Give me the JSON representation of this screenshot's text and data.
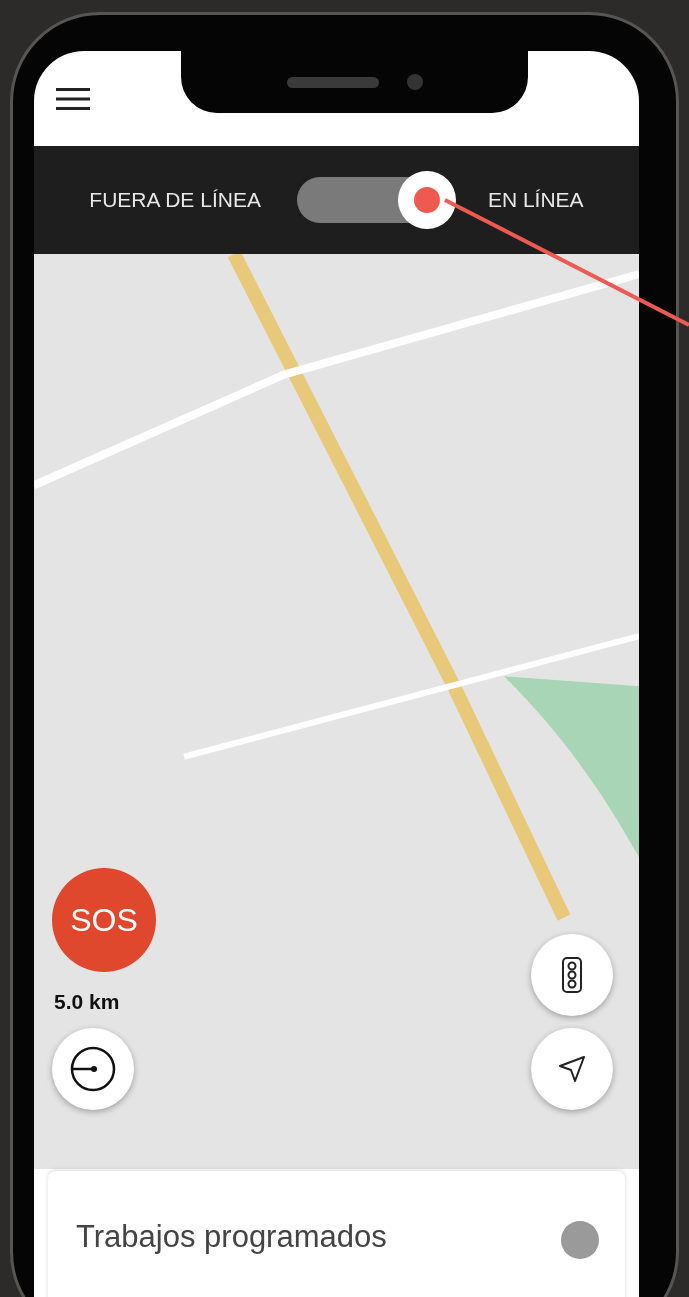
{
  "status_toggle": {
    "off_label": "FUERA DE LÍNEA",
    "on_label": "EN LÍNEA",
    "on": true
  },
  "sos_button": {
    "label": "SOS"
  },
  "radius": {
    "reading": "5.0 km"
  },
  "scheduled_jobs": {
    "title": "Trabajos programados"
  }
}
